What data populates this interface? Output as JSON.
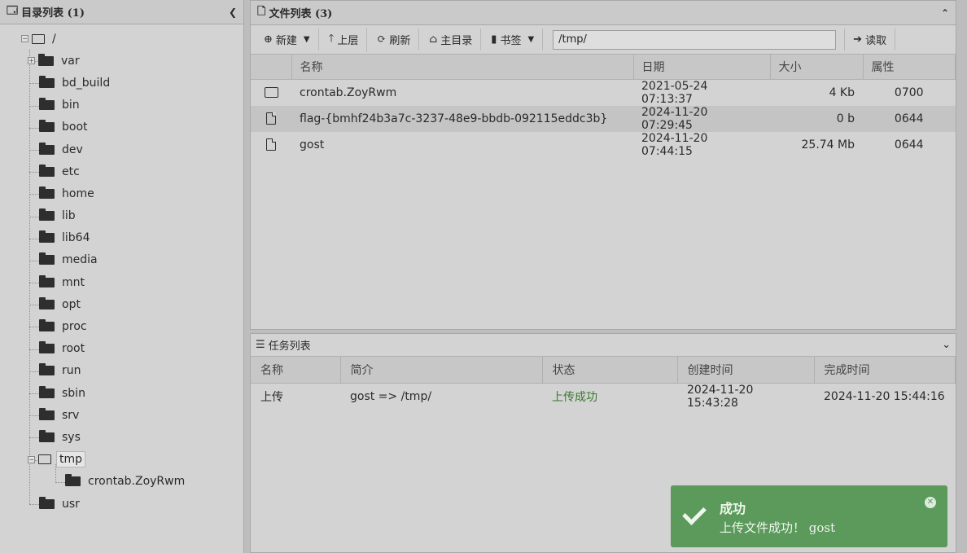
{
  "dir_panel": {
    "title": "目录列表 (1)",
    "collapse_icon": "chevron-left-icon",
    "root_label": "/",
    "items": [
      {
        "label": "var",
        "expandable": true
      },
      {
        "label": "bd_build"
      },
      {
        "label": "bin"
      },
      {
        "label": "boot"
      },
      {
        "label": "dev"
      },
      {
        "label": "etc"
      },
      {
        "label": "home"
      },
      {
        "label": "lib"
      },
      {
        "label": "lib64"
      },
      {
        "label": "media"
      },
      {
        "label": "mnt"
      },
      {
        "label": "opt"
      },
      {
        "label": "proc"
      },
      {
        "label": "root"
      },
      {
        "label": "run"
      },
      {
        "label": "sbin"
      },
      {
        "label": "srv"
      },
      {
        "label": "sys"
      },
      {
        "label": "tmp",
        "expanded": true,
        "selected": true
      },
      {
        "label": "crontab.ZoyRwm",
        "child": true
      },
      {
        "label": "usr"
      }
    ]
  },
  "file_panel": {
    "title": "文件列表 (3)",
    "toolbar": {
      "new_label": "新建",
      "up_label": "上层",
      "refresh_label": "刷新",
      "home_label": "主目录",
      "bookmark_label": "书签",
      "path_value": "/tmp/",
      "read_label": "读取"
    },
    "columns": [
      "名称",
      "日期",
      "大小",
      "属性"
    ],
    "rows": [
      {
        "type": "folder",
        "name": "crontab.ZoyRwm",
        "date": "2021-05-24 07:13:37",
        "size": "4 Kb",
        "perm": "0700"
      },
      {
        "type": "file",
        "name": "flag-{bmhf24b3a7c-3237-48e9-bbdb-092115eddc3b}",
        "date": "2024-11-20 07:29:45",
        "size": "0 b",
        "perm": "0644"
      },
      {
        "type": "file",
        "name": "gost",
        "date": "2024-11-20 07:44:15",
        "size": "25.74 Mb",
        "perm": "0644"
      }
    ]
  },
  "task_panel": {
    "title": "任务列表",
    "columns": [
      "名称",
      "简介",
      "状态",
      "创建时间",
      "完成时间"
    ],
    "rows": [
      {
        "name": "上传",
        "desc": "gost => /tmp/",
        "status": "上传成功",
        "created": "2024-11-20 15:43:28",
        "finished": "2024-11-20 15:44:16"
      }
    ]
  },
  "toast": {
    "title": "成功",
    "message": "上传文件成功！ gost",
    "color": "#5b9a5b"
  }
}
